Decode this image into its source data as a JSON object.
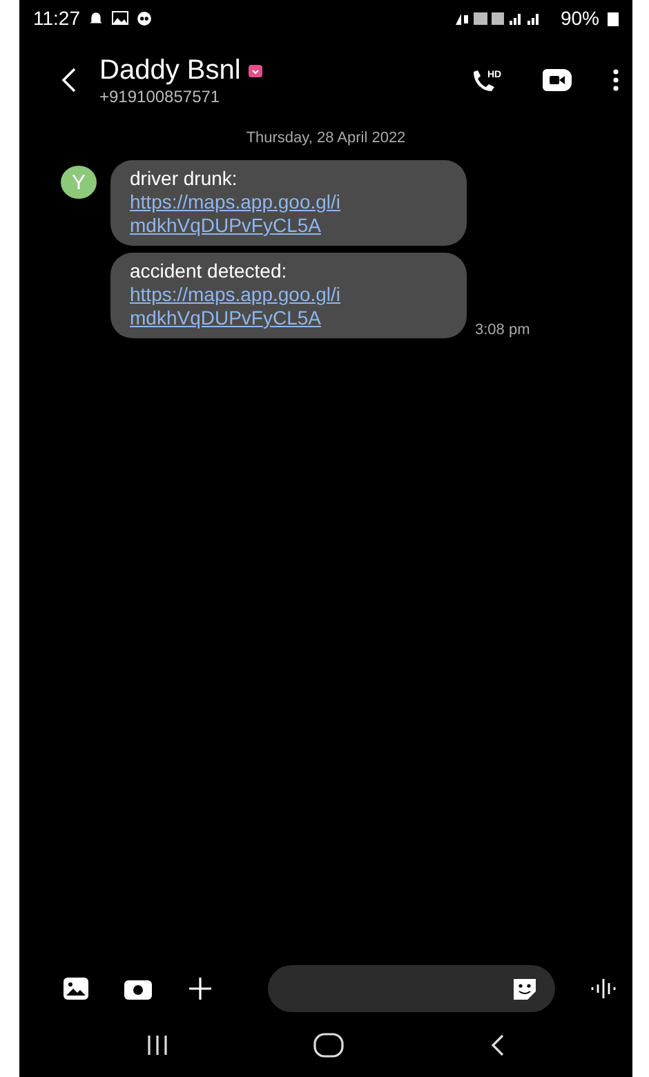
{
  "status_bar": {
    "time": "11:27",
    "battery": "90%"
  },
  "header": {
    "name": "Daddy Bsnl",
    "number": "+919100857571",
    "call_badge": "HD"
  },
  "date_divider": "Thursday, 28 April 2022",
  "avatar": {
    "initial": "Y"
  },
  "messages": [
    {
      "text": "driver drunk:",
      "link": "https://maps.app.goo.gl/imdkhVqDUPvFyCL5A"
    },
    {
      "text": "accident detected:",
      "link": "https://maps.app.goo.gl/imdkhVqDUPvFyCL5A",
      "time": "3:08 pm"
    }
  ],
  "nav_bar": {
    "home": true
  }
}
